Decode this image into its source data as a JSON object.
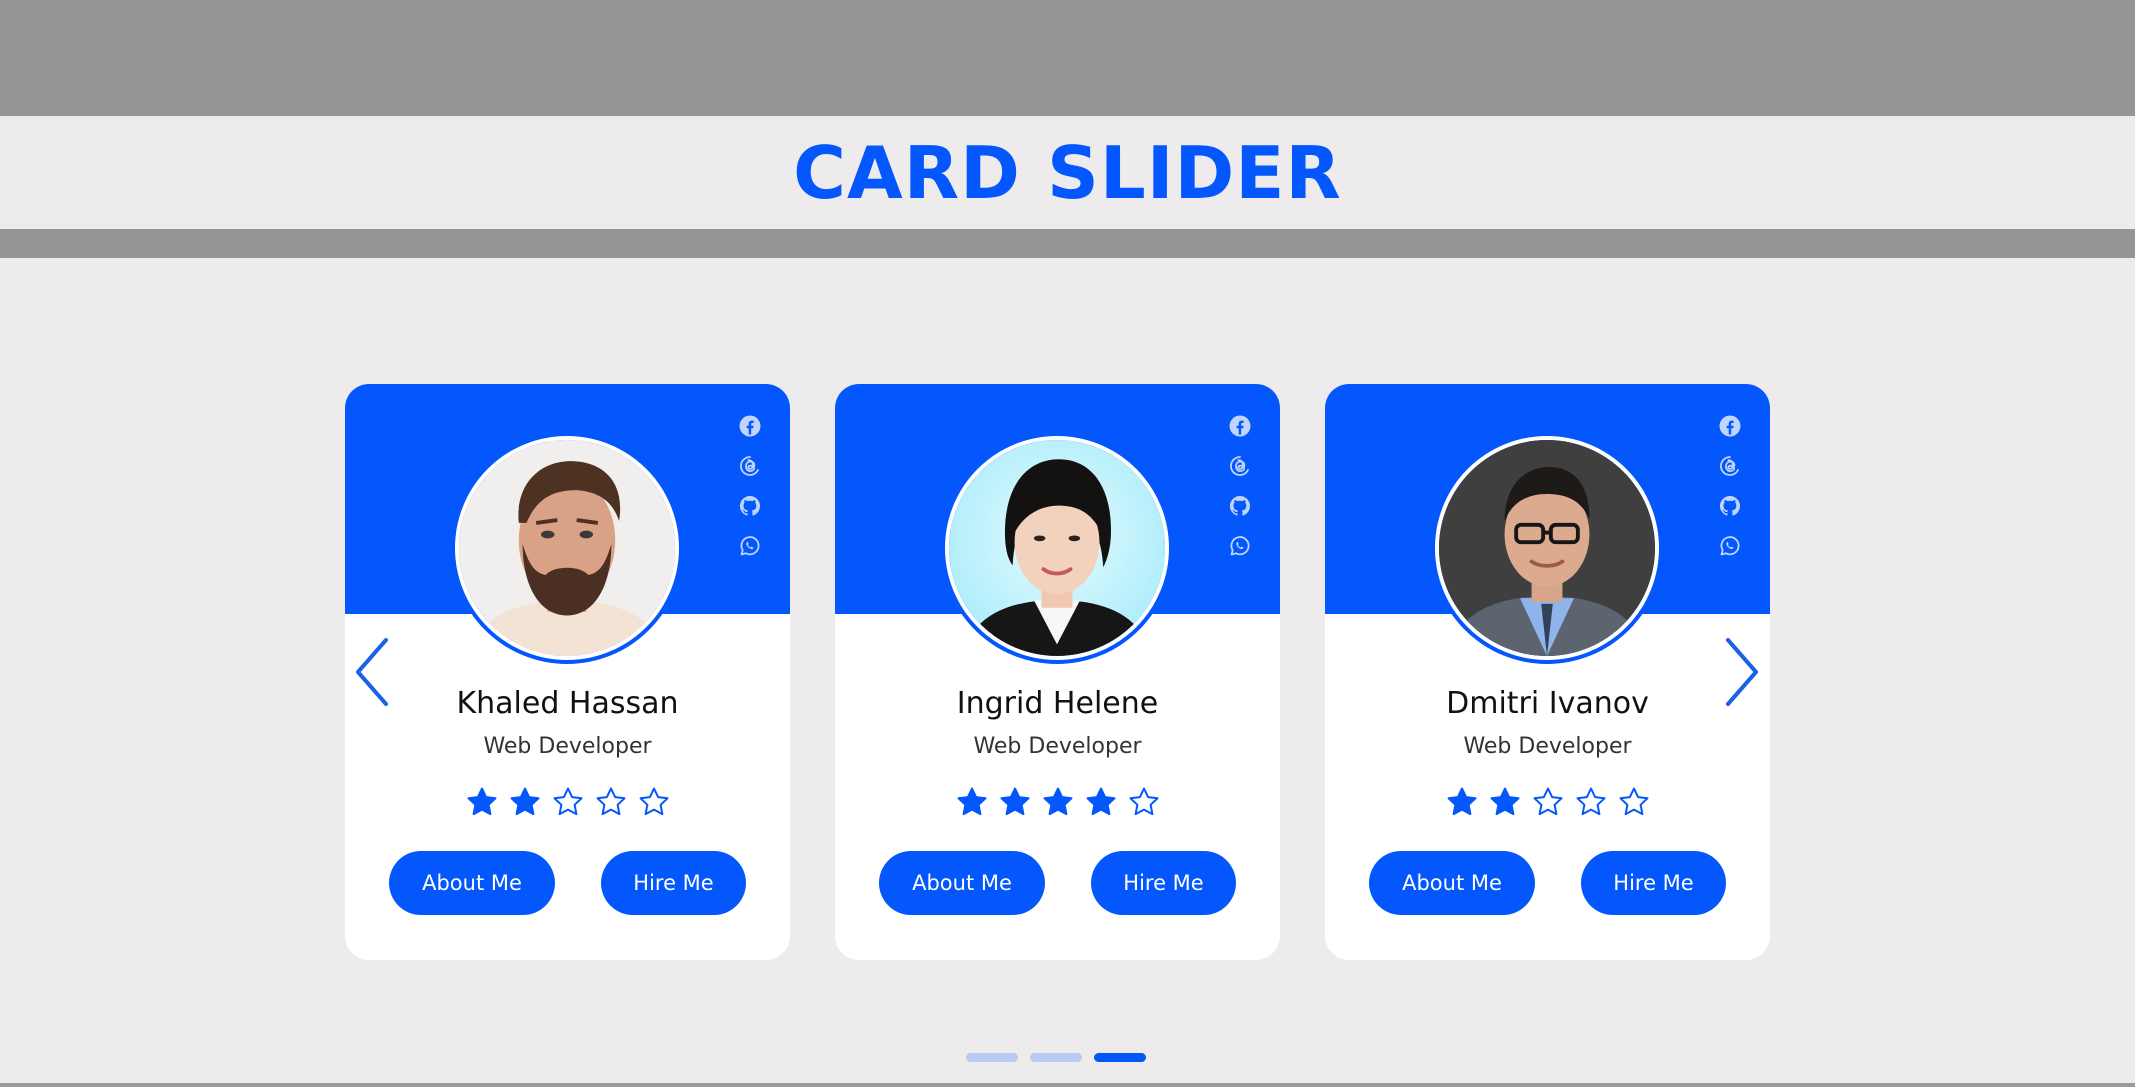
{
  "page": {
    "title": "CARD SLIDER",
    "accent_color": "#0457fc",
    "background": "#edebec"
  },
  "slider": {
    "prev_icon": "chevron-left-icon",
    "next_icon": "chevron-right-icon",
    "dot_count": 3,
    "active_dot": 3
  },
  "cards": [
    {
      "name": "Khaled Hassan",
      "role": "Web Developer",
      "rating": 2,
      "max_rating": 5,
      "about_label": "About Me",
      "hire_label": "Hire Me",
      "socials": [
        "facebook-icon",
        "threads-icon",
        "github-icon",
        "whatsapp-icon"
      ]
    },
    {
      "name": "Ingrid Helene",
      "role": "Web Developer",
      "rating": 4,
      "max_rating": 5,
      "about_label": "About Me",
      "hire_label": "Hire Me",
      "socials": [
        "facebook-icon",
        "threads-icon",
        "github-icon",
        "whatsapp-icon"
      ]
    },
    {
      "name": "Dmitri Ivanov",
      "role": "Web Developer",
      "rating": 2,
      "max_rating": 5,
      "about_label": "About Me",
      "hire_label": "Hire Me",
      "socials": [
        "facebook-icon",
        "threads-icon",
        "github-icon",
        "whatsapp-icon"
      ]
    }
  ]
}
